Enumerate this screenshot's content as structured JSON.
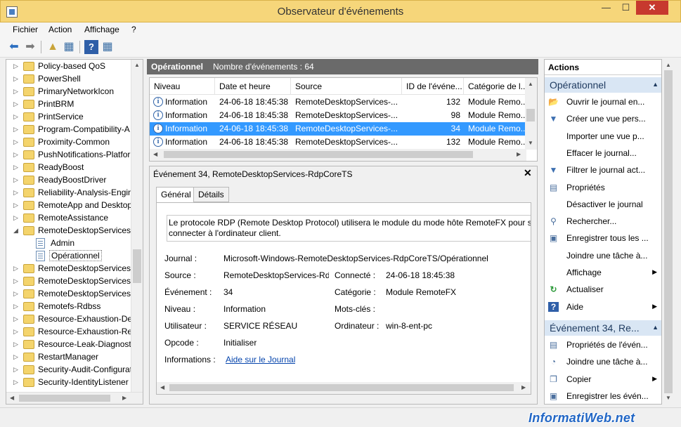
{
  "window": {
    "title": "Observateur d'événements"
  },
  "menu": [
    "Fichier",
    "Action",
    "Affichage",
    "?"
  ],
  "tree": {
    "items": [
      {
        "label": "Policy-based QoS",
        "type": "folder",
        "expandable": true
      },
      {
        "label": "PowerShell",
        "type": "folder",
        "expandable": true
      },
      {
        "label": "PrimaryNetworkIcon",
        "type": "folder",
        "expandable": true
      },
      {
        "label": "PrintBRM",
        "type": "folder",
        "expandable": true
      },
      {
        "label": "PrintService",
        "type": "folder",
        "expandable": true
      },
      {
        "label": "Program-Compatibility-A",
        "type": "folder",
        "expandable": true
      },
      {
        "label": "Proximity-Common",
        "type": "folder",
        "expandable": true
      },
      {
        "label": "PushNotifications-Platfor",
        "type": "folder",
        "expandable": true
      },
      {
        "label": "ReadyBoost",
        "type": "folder",
        "expandable": true
      },
      {
        "label": "ReadyBoostDriver",
        "type": "folder",
        "expandable": true
      },
      {
        "label": "Reliability-Analysis-Engin",
        "type": "folder",
        "expandable": true
      },
      {
        "label": "RemoteApp and Desktop",
        "type": "folder",
        "expandable": true
      },
      {
        "label": "RemoteAssistance",
        "type": "folder",
        "expandable": true
      },
      {
        "label": "RemoteDesktopServices-R",
        "type": "folder",
        "expandable": true,
        "expanded": true
      },
      {
        "label": "Admin",
        "type": "log",
        "indent": 1
      },
      {
        "label": "Opérationnel",
        "type": "log",
        "indent": 1,
        "selected": true
      },
      {
        "label": "RemoteDesktopServices-v",
        "type": "folder",
        "expandable": true
      },
      {
        "label": "RemoteDesktopServices-v",
        "type": "folder",
        "expandable": true
      },
      {
        "label": "RemoteDesktopServices-v",
        "type": "folder",
        "expandable": true
      },
      {
        "label": "Remotefs-Rdbss",
        "type": "folder",
        "expandable": true
      },
      {
        "label": "Resource-Exhaustion-Dete",
        "type": "folder",
        "expandable": true
      },
      {
        "label": "Resource-Exhaustion-Reso",
        "type": "folder",
        "expandable": true
      },
      {
        "label": "Resource-Leak-Diagnostic",
        "type": "folder",
        "expandable": true
      },
      {
        "label": "RestartManager",
        "type": "folder",
        "expandable": true
      },
      {
        "label": "Security-Audit-Configurat",
        "type": "folder",
        "expandable": true
      },
      {
        "label": "Security-IdentityListener",
        "type": "folder",
        "expandable": true
      }
    ]
  },
  "center": {
    "title": "Opérationnel",
    "count": "Nombre d'événements : 64"
  },
  "event_list": {
    "columns": [
      "Niveau",
      "Date et heure",
      "Source",
      "ID de l'événe...",
      "Catégorie de l..."
    ],
    "rows": [
      {
        "level": "Information",
        "date": "24-06-18 18:45:38",
        "source": "RemoteDesktopServices-...",
        "id": "132",
        "category": "Module Remo...",
        "selected": false
      },
      {
        "level": "Information",
        "date": "24-06-18 18:45:38",
        "source": "RemoteDesktopServices-...",
        "id": "98",
        "category": "Module Remo...",
        "selected": false
      },
      {
        "level": "Information",
        "date": "24-06-18 18:45:38",
        "source": "RemoteDesktopServices-...",
        "id": "34",
        "category": "Module Remo...",
        "selected": true
      },
      {
        "level": "Information",
        "date": "24-06-18 18:45:38",
        "source": "RemoteDesktopServices-...",
        "id": "132",
        "category": "Module Remo...",
        "selected": false
      }
    ]
  },
  "details": {
    "title": "Événement 34, RemoteDesktopServices-RdpCoreTS",
    "tabs": [
      "Général",
      "Détails"
    ],
    "description_line1": "Le protocole RDP (Remote Desktop Protocol) utilisera le module du mode hôte RemoteFX pour se",
    "description_line2": "connecter à l'ordinateur client.",
    "fields": {
      "journal_label": "Journal :",
      "journal_value": "Microsoft-Windows-RemoteDesktopServices-RdpCoreTS/Opérationnel",
      "source_label": "Source :",
      "source_value": "RemoteDesktopServices-Rdp",
      "connecte_label": "Connecté :",
      "connecte_value": "24-06-18 18:45:38",
      "evenement_label": "Événement :",
      "evenement_value": "34",
      "categorie_label": "Catégorie :",
      "categorie_value": "Module RemoteFX",
      "niveau_label": "Niveau :",
      "niveau_value": "Information",
      "motscles_label": "Mots-clés :",
      "motscles_value": "",
      "utilisateur_label": "Utilisateur :",
      "utilisateur_value": "SERVICE RÉSEAU",
      "ordinateur_label": "Ordinateur :",
      "ordinateur_value": "win-8-ent-pc",
      "opcode_label": "Opcode :",
      "opcode_value": "Initialiser",
      "informations_label": "Informations :",
      "informations_link": "Aide sur le Journal"
    }
  },
  "actions": {
    "header": "Actions",
    "section1": "Opérationnel",
    "section1_items": [
      {
        "label": "Ouvrir le journal en...",
        "icon": "folder-open-icon",
        "glyph": "📂"
      },
      {
        "label": "Créer une vue pers...",
        "icon": "filter-new-icon",
        "glyph": "▼"
      },
      {
        "label": "Importer une vue p...",
        "icon": "",
        "glyph": ""
      },
      {
        "label": "Effacer le journal...",
        "icon": "",
        "glyph": ""
      },
      {
        "label": "Filtrer le journal act...",
        "icon": "filter-icon",
        "glyph": "▼"
      },
      {
        "label": "Propriétés",
        "icon": "properties-icon",
        "glyph": "▤"
      },
      {
        "label": "Désactiver le journal",
        "icon": "",
        "glyph": ""
      },
      {
        "label": "Rechercher...",
        "icon": "find-icon",
        "glyph": "⚲"
      },
      {
        "label": "Enregistrer tous les ...",
        "icon": "save-icon",
        "glyph": "▣"
      },
      {
        "label": "Joindre une tâche à...",
        "icon": "",
        "glyph": ""
      },
      {
        "label": "Affichage",
        "icon": "",
        "glyph": "",
        "submenu": true
      },
      {
        "label": "Actualiser",
        "icon": "refresh-icon",
        "glyph": "↻"
      },
      {
        "label": "Aide",
        "icon": "help-icon",
        "glyph": "?",
        "submenu": true
      }
    ],
    "section2": "Événement 34, Re...",
    "section2_items": [
      {
        "label": "Propriétés de l'évén...",
        "icon": "event-properties-icon",
        "glyph": "▤"
      },
      {
        "label": "Joindre une tâche à...",
        "icon": "attach-task-icon",
        "glyph": "◔"
      },
      {
        "label": "Copier",
        "icon": "copy-icon",
        "glyph": "❐",
        "submenu": true
      },
      {
        "label": "Enregistrer les évén...",
        "icon": "save-events-icon",
        "glyph": "▣"
      }
    ]
  },
  "watermark": "InformatiWeb.net",
  "colors": {
    "titlebar": "#f6d67a",
    "selection": "#3399ff",
    "header": "#6a6a6a",
    "section": "#d9e6f4"
  }
}
